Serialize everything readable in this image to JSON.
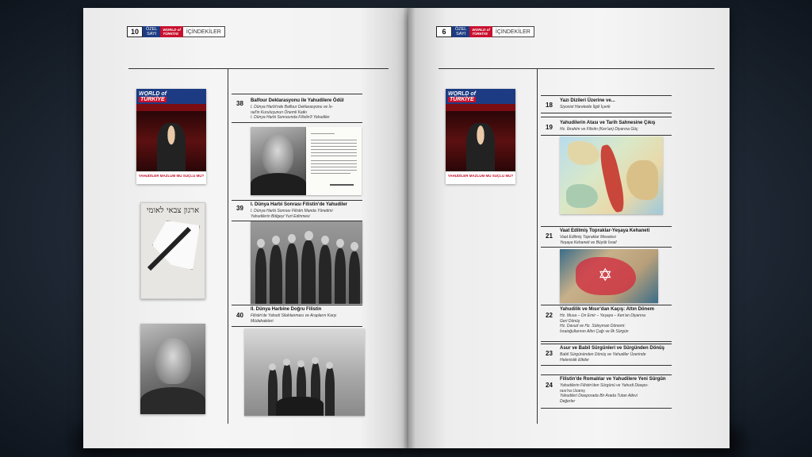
{
  "left_page": {
    "header": {
      "page_number": "10",
      "ozel": "ÖZEL",
      "sayi": "SAYI",
      "logo_line1": "WORLD of",
      "logo_line2": "TÜRKİYE",
      "section": "İÇİNDEKİLER"
    },
    "cover": {
      "brand_line1": "WORLD of",
      "brand_line2": "TÜRKİYE",
      "footline": "YAHUDİLER MAZLUM MU SUÇLU MU?"
    },
    "poster": {
      "heading": "ארגון צבאי לאומי"
    },
    "entries": [
      {
        "number": "38",
        "title": "Balfour Deklarasyonu ile Yahudilere Ödül",
        "subtitles": [
          "I. Dünya Harbi'nde Balfour Deklarasyonu ve İs-",
          "rail'in Kuruluşunun Önemli Katkı",
          "I. Dünya Harbi Sonrasında Filistin'li Yahudiler"
        ]
      },
      {
        "number": "39",
        "title": "I. Dünya Harbi Sonrası Filistin'de Yahudiler",
        "subtitles": [
          "I. Dünya Harbi Sonrası Filistin Manda Yönetimi",
          "Yahudilerin Bölgeyi Yurt Edinmesi"
        ]
      },
      {
        "number": "40",
        "title": "II. Dünya Harbine Doğru Filistin",
        "subtitles": [
          "Filistin'de Yahudi Silahlanması ve Arapların Karşı",
          "Müdahaleleri"
        ]
      }
    ]
  },
  "right_page": {
    "header": {
      "page_number": "6",
      "ozel": "ÖZEL",
      "sayi": "SAYI",
      "logo_line1": "WORLD of",
      "logo_line2": "TÜRKİYE",
      "section": "İÇİNDEKİLER"
    },
    "cover": {
      "brand_line1": "WORLD of",
      "brand_line2": "TÜRKİYE",
      "footline": "YAHUDİLER MAZLUM MU SUÇLU MU?"
    },
    "entries": [
      {
        "number": "18",
        "title": "Yazı Dizileri Üzerine ve...",
        "subtitles": [
          "Siyonist Hareketle İlgili İçerik"
        ]
      },
      {
        "number": "19",
        "title": "Yahudilerin Atası ve Tarih Sahnesine Çıkış",
        "subtitles": [
          "Hz. İbrahim ve Filistin (Ken'an) Diyarına Göç"
        ]
      },
      {
        "number": "21",
        "title": "Vaat Edilmiş Topraklar-Yeşaya Kehaneti",
        "subtitles": [
          "Vaat Edilmiş Topraklar Meselesi",
          "Yeşaya Kehaneti ve Büyük İsrail"
        ]
      },
      {
        "number": "22",
        "title": "Yahudilik ve Mısır'dan Kaçış: Altın Dönem",
        "subtitles": [
          "Hz. Musa – On Emir – Yeşaya – Ken'an Diyarına",
          "Geri Dönüş",
          "Hz. Davud ve Hz. Süleyman Dönemi:",
          "İsraioğullarının Altın Çağı ve İlk Sürgün"
        ]
      },
      {
        "number": "23",
        "title": "Asur ve Babil Sürgünleri ve Sürgünden Dönüş",
        "subtitles": [
          "Babil Sürgününden Dönüş ve Yahudiler Üzerinde",
          "Helenistik Etkiler"
        ]
      },
      {
        "number": "24",
        "title": "Filistin'de Romalılar ve Yahudilere Yeni Sürgün",
        "subtitles": [
          "Yahudilerin Filistin'den Sürgünü ve Yahudi Diaspo-",
          "rası'na Uzanış",
          "Yahudileri Diasporada Bir Arada Tutan Ailevi",
          "Değerler"
        ]
      }
    ]
  }
}
